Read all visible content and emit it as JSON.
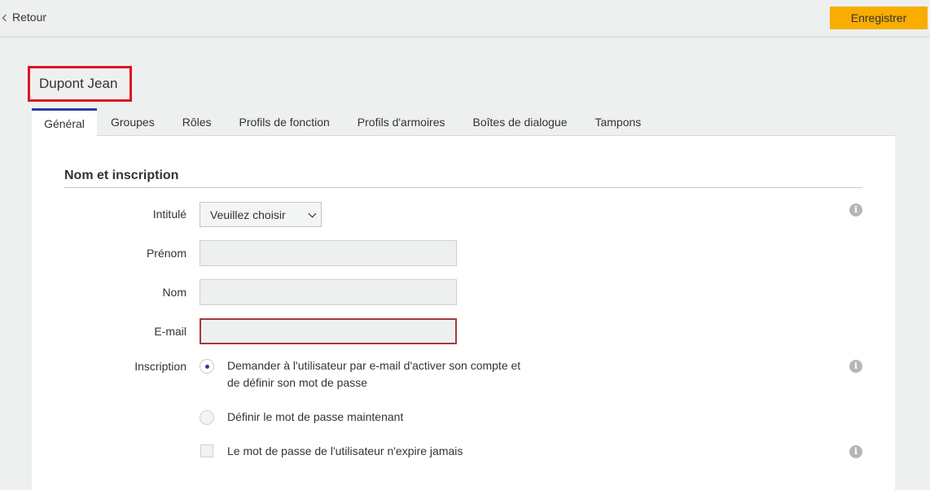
{
  "header": {
    "back_label": "Retour",
    "save_label": "Enregistrer",
    "save_color": "#f8ad00"
  },
  "user": {
    "name": "Dupont Jean",
    "highlight_color": "#e0141c"
  },
  "tabs": [
    {
      "label": "Général",
      "active": true
    },
    {
      "label": "Groupes",
      "active": false
    },
    {
      "label": "Rôles",
      "active": false
    },
    {
      "label": "Profils de fonction",
      "active": false
    },
    {
      "label": "Profils d'armoires",
      "active": false
    },
    {
      "label": "Boîtes de dialogue",
      "active": false
    },
    {
      "label": "Tampons",
      "active": false
    }
  ],
  "section": {
    "title": "Nom et inscription"
  },
  "form": {
    "title_label": "Intitulé",
    "title_select_value": "Veuillez choisir",
    "firstname_label": "Prénom",
    "firstname_value": "",
    "lastname_label": "Nom",
    "lastname_value": "",
    "email_label": "E-mail",
    "email_value": "",
    "registration_label": "Inscription",
    "registration_options": [
      {
        "line1": "Demander à l'utilisateur par e-mail d'activer son compte et",
        "line2": "de définir son mot de passe",
        "selected": true
      },
      {
        "line1": "Définir le mot de passe maintenant",
        "selected": false
      }
    ],
    "no_expire_label": "Le mot de passe de l'utilisateur n'expire jamais",
    "no_expire_checked": false
  },
  "icons": {
    "back": "chevron-left-icon",
    "info": "info-icon",
    "dropdown": "chevron-down-icon"
  },
  "accent_color": "#2a3d9a",
  "error_color": "#a33a3a"
}
